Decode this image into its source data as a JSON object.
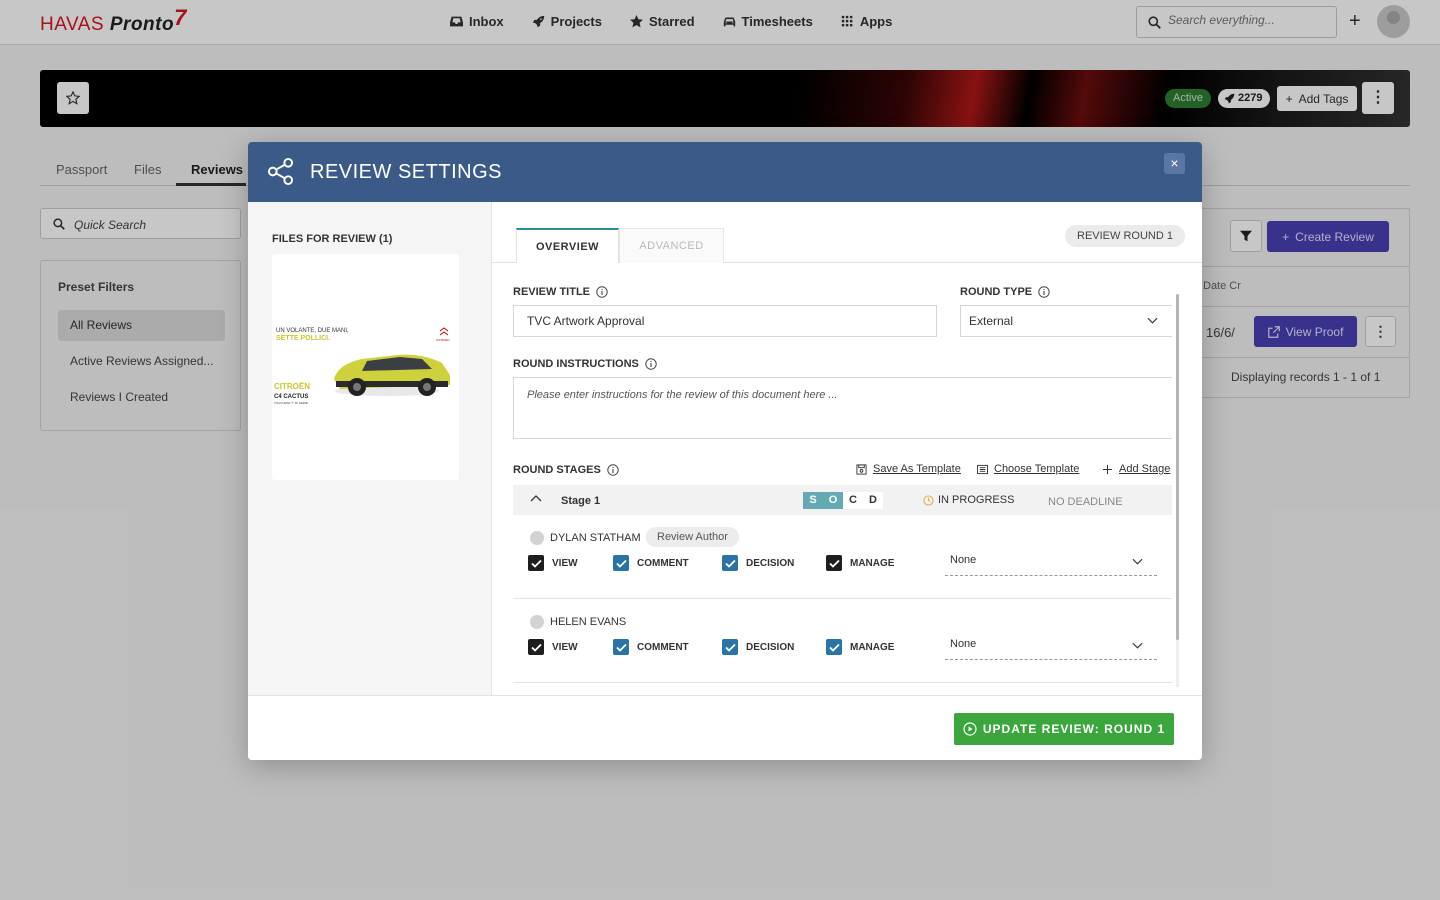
{
  "app": {
    "logo_brand": "HAVAS",
    "logo_product": "Pronto",
    "logo_mark": "7"
  },
  "nav": {
    "items": [
      {
        "label": "Inbox",
        "icon": "inbox-icon"
      },
      {
        "label": "Projects",
        "icon": "rocket-icon"
      },
      {
        "label": "Starred",
        "icon": "star-icon"
      },
      {
        "label": "Timesheets",
        "icon": "car-icon"
      },
      {
        "label": "Apps",
        "icon": "grid-icon"
      }
    ],
    "search_placeholder": "Search everything...",
    "plus_label": "+"
  },
  "banner": {
    "status": "Active",
    "count": "2279",
    "add_tags_label": "Add Tags",
    "kebab": "⋮"
  },
  "page_tabs": [
    "Passport",
    "Files",
    "Reviews"
  ],
  "active_page_tab": "Reviews",
  "left_panel": {
    "quick_search_placeholder": "Quick Search",
    "preset_title": "Preset Filters",
    "preset_items": [
      "All Reviews",
      "Active Reviews Assigned...",
      "Reviews I Created"
    ]
  },
  "right_panel": {
    "create_review_label": "Create Review",
    "date_header": "Date Cr",
    "date_value": "16/6/",
    "view_proof_label": "View Proof",
    "kebab": "⋮",
    "records_text": "Displaying records 1 - 1 of 1"
  },
  "modal": {
    "title": "REVIEW SETTINGS",
    "close": "×",
    "files_title": "FILES FOR REVIEW (1)",
    "thumbnail": {
      "headline_1": "UN VOLANTE, DUE MANI,",
      "headline_2": "SETTE POLLICI.",
      "brand": "CITROËN",
      "model": "C4 CACTUS",
      "tagline": "TOUCHPAD 7\" DI SERIE.",
      "logo_text": "CITROËN"
    },
    "tabs": {
      "overview": "OVERVIEW",
      "advanced": "ADVANCED"
    },
    "round_pill": "REVIEW ROUND 1",
    "review_title_label": "REVIEW TITLE",
    "review_title_value": "TVC Artwork Approval",
    "round_type_label": "ROUND TYPE",
    "round_type_value": "External",
    "instructions_label": "ROUND INSTRUCTIONS",
    "instructions_placeholder": "Please enter instructions for the review of this document here ...",
    "stages_label": "ROUND STAGES",
    "save_template_label": "Save As Template",
    "choose_template_label": "Choose Template",
    "add_stage_label": "Add Stage",
    "stage": {
      "name": "Stage 1",
      "socd": [
        "S",
        "O",
        "C",
        "D"
      ],
      "socd_active": [
        true,
        true,
        false,
        false
      ],
      "status": "IN PROGRESS",
      "deadline": "NO DEADLINE"
    },
    "reviewers": [
      {
        "name": "DYLAN STATHAM",
        "role": "Review Author",
        "permissions": [
          {
            "label": "VIEW",
            "checked": true,
            "style": "dark"
          },
          {
            "label": "COMMENT",
            "checked": true,
            "style": "blue"
          },
          {
            "label": "DECISION",
            "checked": true,
            "style": "blue"
          },
          {
            "label": "MANAGE",
            "checked": true,
            "style": "dark"
          }
        ],
        "select_value": "None"
      },
      {
        "name": "HELEN EVANS",
        "role": "",
        "permissions": [
          {
            "label": "VIEW",
            "checked": true,
            "style": "dark"
          },
          {
            "label": "COMMENT",
            "checked": true,
            "style": "blue"
          },
          {
            "label": "DECISION",
            "checked": true,
            "style": "blue"
          },
          {
            "label": "MANAGE",
            "checked": true,
            "style": "blue"
          }
        ],
        "select_value": "None"
      }
    ],
    "update_button_label": "UPDATE REVIEW: ROUND 1"
  },
  "colors": {
    "header_blue": "#3c5a87",
    "accent_purple": "#4a40b5",
    "success_green": "#3aa63d",
    "brand_red": "#d6171f",
    "teal_tab": "#2d8f95"
  }
}
